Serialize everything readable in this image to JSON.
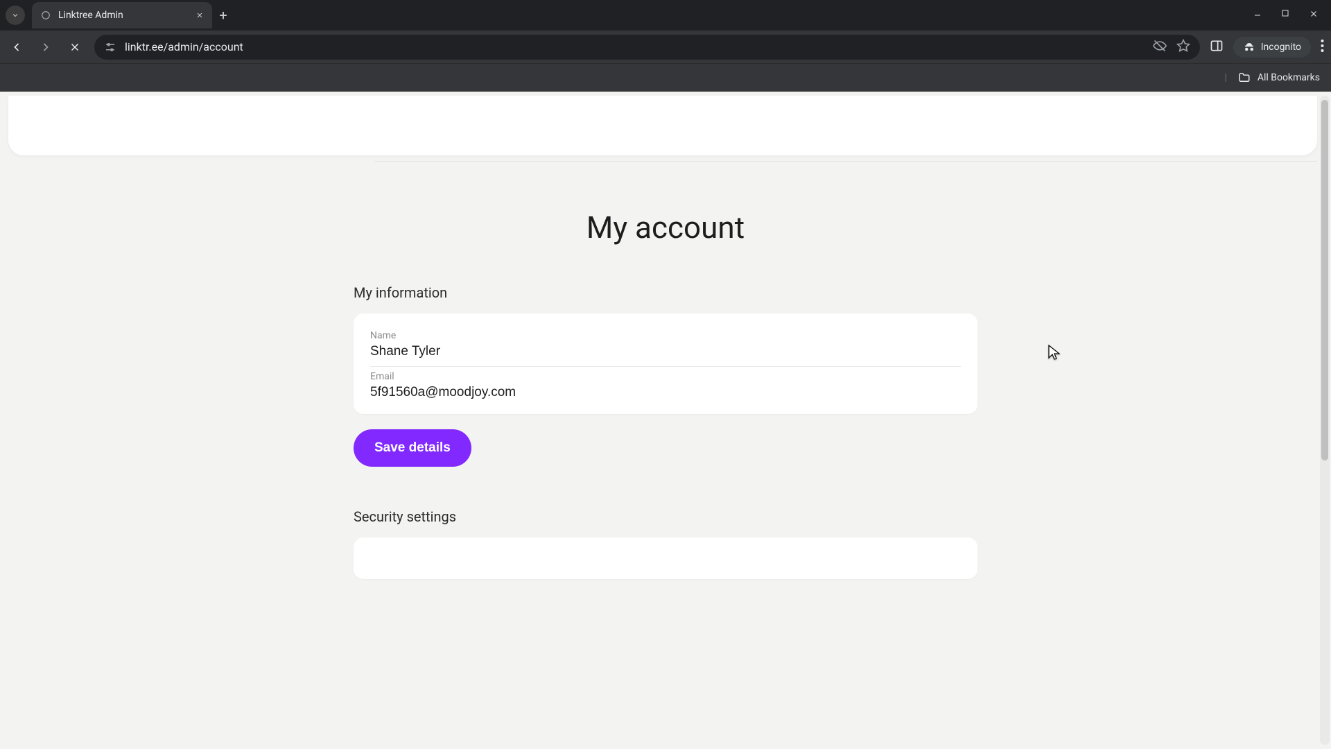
{
  "browser": {
    "tab_title": "Linktree Admin",
    "url": "linktr.ee/admin/account",
    "incognito_label": "Incognito",
    "all_bookmarks_label": "All Bookmarks"
  },
  "page": {
    "title": "My account",
    "sections": {
      "info": {
        "label": "My information",
        "name_label": "Name",
        "name_value": "Shane Tyler",
        "email_label": "Email",
        "email_value": "5f91560a@moodjoy.com",
        "save_label": "Save details"
      },
      "security": {
        "label": "Security settings"
      }
    }
  },
  "colors": {
    "accent": "#8129ff"
  }
}
